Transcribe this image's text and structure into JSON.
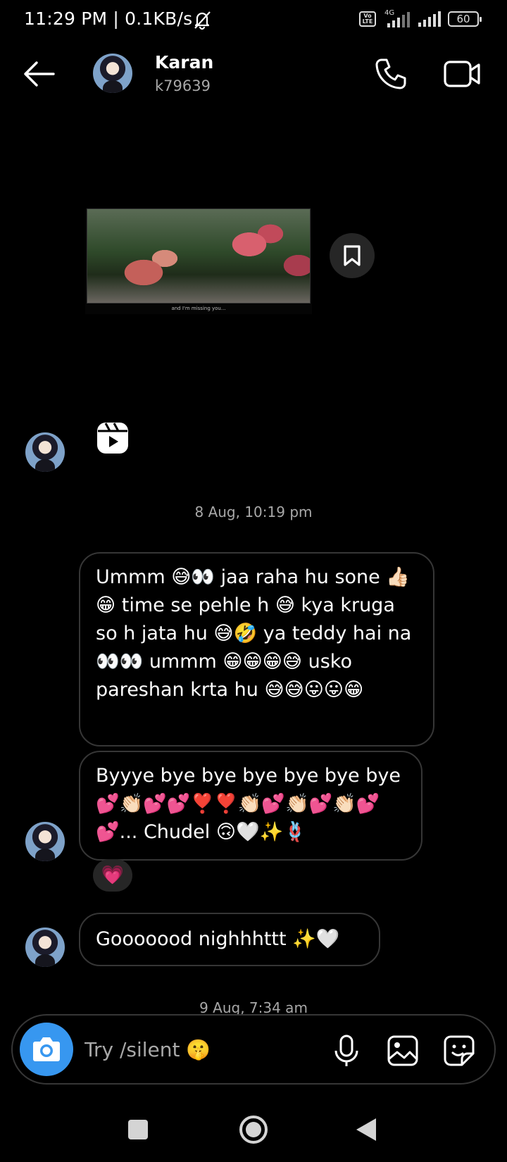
{
  "status_bar": {
    "time_speed": "11:29 PM | 0.1KB/s",
    "volte": "Vo LTE",
    "network": "4G",
    "battery": "60"
  },
  "header": {
    "contact_name": "Karan",
    "contact_handle": "k79639"
  },
  "shared_media": {
    "caption": "and I'm missing you..."
  },
  "thread": {
    "date_1": "8 Aug, 10:19 pm",
    "message_1": "Ummm 😅👀 jaa raha hu sone 👍🏻😁 time se pehle h 😅 kya kruga so h jata hu 😅🤣 ya teddy hai na 👀👀 ummm 😁😁😁😅 usko pareshan krta hu 😅😅😛😛😁",
    "message_2": "Byyye bye bye bye bye bye bye 💕👏🏻💕💕❣️❣️👏🏻💕👏🏻💕👏🏻💕💕... Chudel 🙃🤍✨🪢",
    "message_2_reaction": "💗",
    "message_3": "Gooooood nighhhttt  ✨🤍",
    "date_2": "9 Aug, 7:34 am"
  },
  "composer": {
    "placeholder": "Try /silent 🤫"
  }
}
